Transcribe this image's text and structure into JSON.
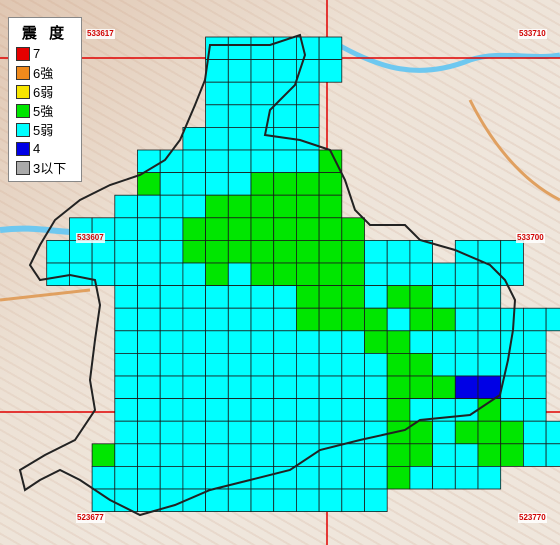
{
  "legend": {
    "title": "震 度",
    "items": [
      {
        "label": "7",
        "color": "#e60000"
      },
      {
        "label": "6強",
        "color": "#f08a1c"
      },
      {
        "label": "6弱",
        "color": "#f7e600"
      },
      {
        "label": "5強",
        "color": "#00e600"
      },
      {
        "label": "5弱",
        "color": "#00ffff"
      },
      {
        "label": "4",
        "color": "#0000e6"
      },
      {
        "label": "3以下",
        "color": "#aaaaaa"
      }
    ]
  },
  "mesh_codes": {
    "top_left": "533617",
    "top_right": "533710",
    "mid_left": "533607",
    "mid_right": "533700",
    "bottom_left": "523677",
    "bottom_right": "523770"
  },
  "intensity_grid": {
    "cols": 22,
    "rows": 21,
    "legend": {
      "a": "5弱",
      "g": "5強",
      "b": "4"
    },
    "cells": [
      "........aaaaaa.",
      "........aaaaaa.",
      "........aaaaa..",
      "........aaaaa..",
      ".......aaaaaa..",
      ".....aaaaaaaag.",
      ".....gaaaagggg.",
      "....aaaagggggg.",
      "..aaaaagggggggg.........",
      ".aaaaaaggggggggaaa.aaa..",
      ".aaaaaaagagggggaaaaaaa..",
      "....aaaaaaaagggaggaaa...",
      "....aaaaaaaaggggaggaaaaa",
      "....aaaaaaaaaaaggaaaaaa",
      "....aaaaaaaaaaaaggaaaaa",
      "....aaaaaaaaaaaagggbbaa",
      "....aaaaaaaaaaaagaaagaa",
      "....aaaaaaaaaaaaggagggaa",
      "...gaaaaaaaaaaaaggaaggaa",
      "...aaaaaaaaaaaaagaaaa..",
      "...aaaaaaaaaaaaa......."
    ]
  }
}
